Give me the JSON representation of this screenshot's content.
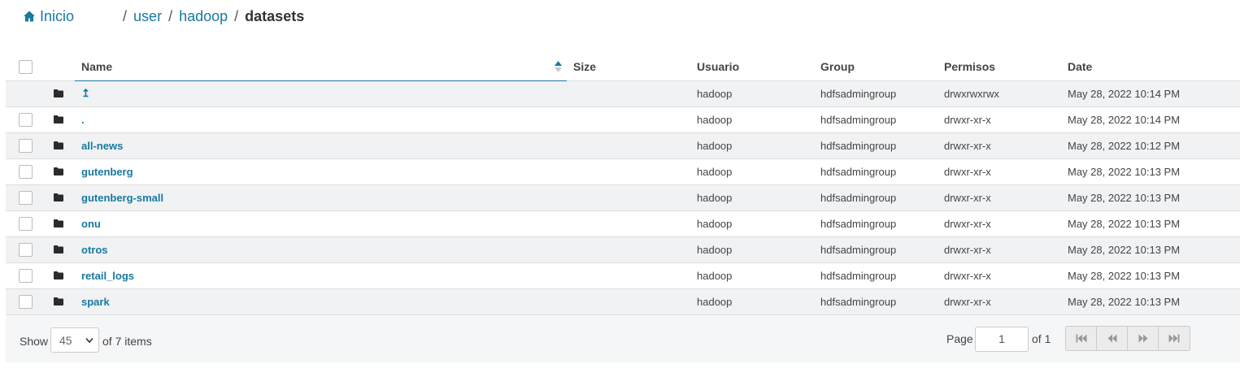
{
  "breadcrumb": {
    "home_label": "Inicio",
    "path": [
      "user",
      "hadoop"
    ],
    "current": "datasets"
  },
  "table": {
    "columns": {
      "name": "Name",
      "size": "Size",
      "user": "Usuario",
      "group": "Group",
      "perms": "Permisos",
      "date": "Date"
    },
    "sort": {
      "column": "Name",
      "direction": "ascending"
    },
    "rows": [
      {
        "name": "↥",
        "size": "",
        "user": "hadoop",
        "group": "hdfsadmingroup",
        "perms": "drwxrwxrwx",
        "date": "May 28, 2022 10:14 PM",
        "has_checkbox": false
      },
      {
        "name": ".",
        "size": "",
        "user": "hadoop",
        "group": "hdfsadmingroup",
        "perms": "drwxr-xr-x",
        "date": "May 28, 2022 10:14 PM",
        "has_checkbox": true
      },
      {
        "name": "all-news",
        "size": "",
        "user": "hadoop",
        "group": "hdfsadmingroup",
        "perms": "drwxr-xr-x",
        "date": "May 28, 2022 10:12 PM",
        "has_checkbox": true
      },
      {
        "name": "gutenberg",
        "size": "",
        "user": "hadoop",
        "group": "hdfsadmingroup",
        "perms": "drwxr-xr-x",
        "date": "May 28, 2022 10:13 PM",
        "has_checkbox": true
      },
      {
        "name": "gutenberg-small",
        "size": "",
        "user": "hadoop",
        "group": "hdfsadmingroup",
        "perms": "drwxr-xr-x",
        "date": "May 28, 2022 10:13 PM",
        "has_checkbox": true
      },
      {
        "name": "onu",
        "size": "",
        "user": "hadoop",
        "group": "hdfsadmingroup",
        "perms": "drwxr-xr-x",
        "date": "May 28, 2022 10:13 PM",
        "has_checkbox": true
      },
      {
        "name": "otros",
        "size": "",
        "user": "hadoop",
        "group": "hdfsadmingroup",
        "perms": "drwxr-xr-x",
        "date": "May 28, 2022 10:13 PM",
        "has_checkbox": true
      },
      {
        "name": "retail_logs",
        "size": "",
        "user": "hadoop",
        "group": "hdfsadmingroup",
        "perms": "drwxr-xr-x",
        "date": "May 28, 2022 10:13 PM",
        "has_checkbox": true
      },
      {
        "name": "spark",
        "size": "",
        "user": "hadoop",
        "group": "hdfsadmingroup",
        "perms": "drwxr-xr-x",
        "date": "May 28, 2022 10:13 PM",
        "has_checkbox": true
      }
    ]
  },
  "footer": {
    "show_label": "Show",
    "page_size": "45",
    "of_items": "of 7 items",
    "page_label": "Page",
    "current_page": "1",
    "of_pages": "of 1"
  },
  "colors": {
    "link": "#1779a0",
    "row_stripe": "#f1f2f4",
    "footer_bg": "#f5f6f7"
  },
  "icons": {
    "home": "home-icon",
    "folder": "folder-icon",
    "sort": "sort-arrows-icon",
    "first": "first-page-icon",
    "prev": "previous-page-icon",
    "next": "next-page-icon",
    "last": "last-page-icon",
    "dropdown": "chevron-down-icon"
  }
}
